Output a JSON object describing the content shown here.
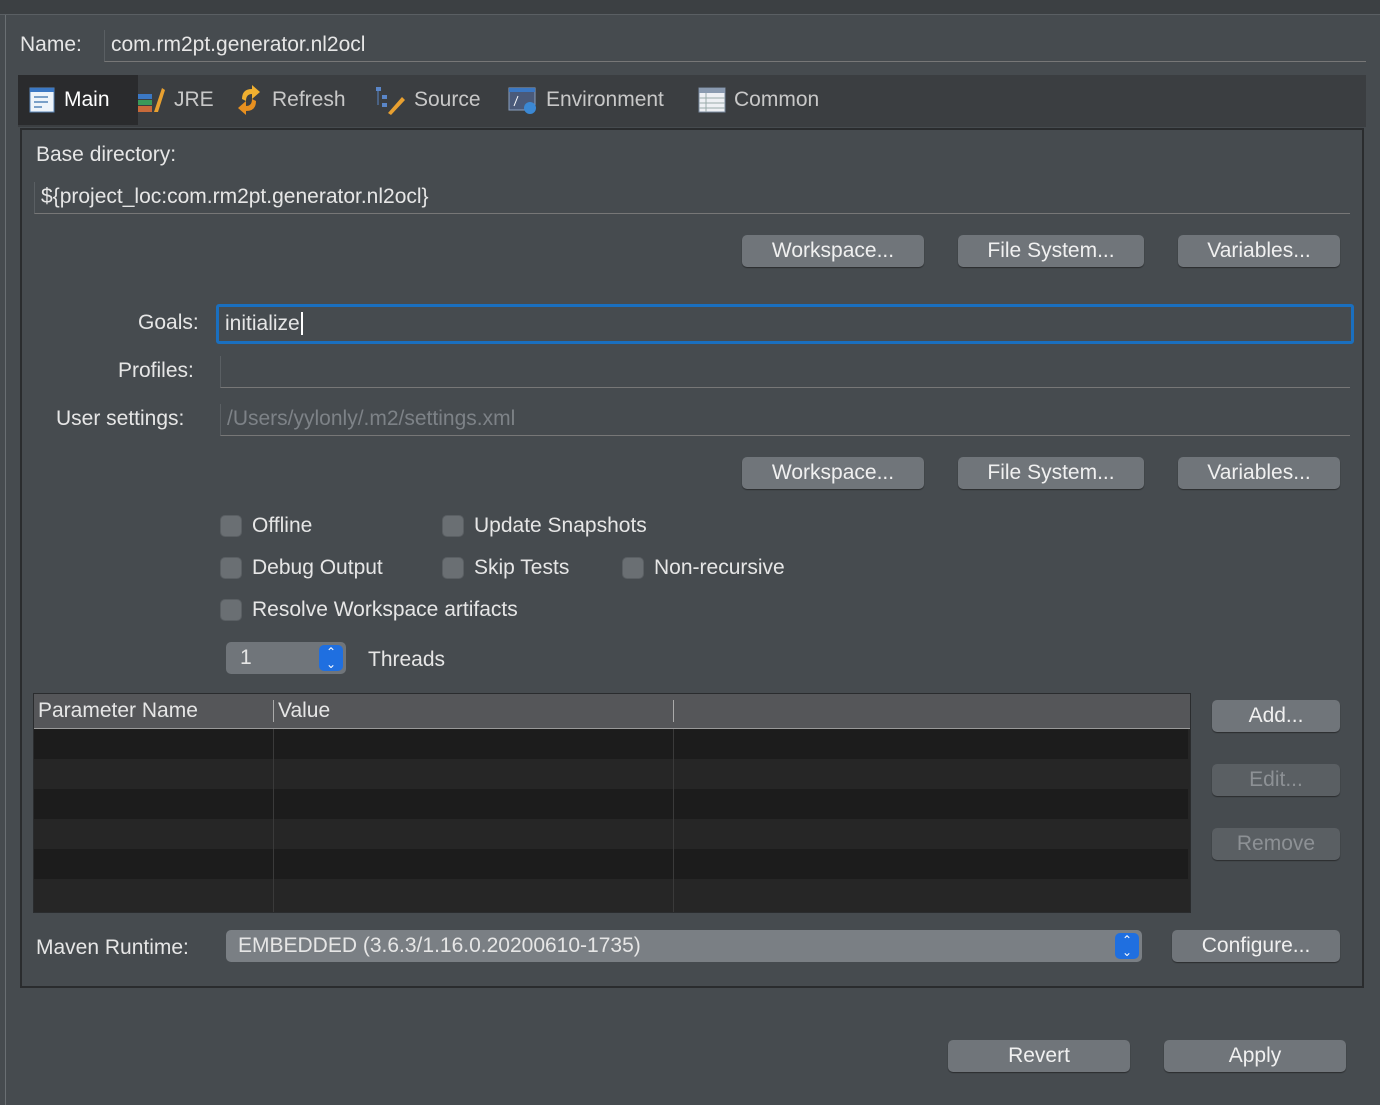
{
  "name": {
    "label": "Name:",
    "value": "com.rm2pt.generator.nl2ocl"
  },
  "tabs": [
    {
      "label": "Main",
      "icon": "main-tab-icon"
    },
    {
      "label": "JRE",
      "icon": "jre-icon"
    },
    {
      "label": "Refresh",
      "icon": "refresh-icon"
    },
    {
      "label": "Source",
      "icon": "source-icon"
    },
    {
      "label": "Environment",
      "icon": "environment-icon"
    },
    {
      "label": "Common",
      "icon": "common-icon"
    }
  ],
  "base_dir": {
    "label": "Base directory:",
    "value": "${project_loc:com.rm2pt.generator.nl2ocl}"
  },
  "buttons": {
    "workspace": "Workspace...",
    "filesystem": "File System...",
    "variables": "Variables...",
    "add": "Add...",
    "edit": "Edit...",
    "remove": "Remove",
    "configure": "Configure...",
    "revert": "Revert",
    "apply": "Apply"
  },
  "goals": {
    "label": "Goals:",
    "value": "initialize"
  },
  "profiles": {
    "label": "Profiles:",
    "value": ""
  },
  "user_settings": {
    "label": "User settings:",
    "placeholder": "/Users/yylonly/.m2/settings.xml"
  },
  "options": {
    "offline": "Offline",
    "update_snapshots": "Update Snapshots",
    "debug_output": "Debug Output",
    "skip_tests": "Skip Tests",
    "non_recursive": "Non-recursive",
    "resolve_workspace": "Resolve Workspace artifacts"
  },
  "threads": {
    "value": "1",
    "label": "Threads"
  },
  "table": {
    "columns": [
      "Parameter Name",
      "Value"
    ],
    "rows": []
  },
  "runtime": {
    "label": "Maven Runtime:",
    "value": "EMBEDDED (3.6.3/1.16.0.20200610-1735)"
  },
  "colors": {
    "focus": "#1a6fbf",
    "accent": "#1f6fe0"
  }
}
